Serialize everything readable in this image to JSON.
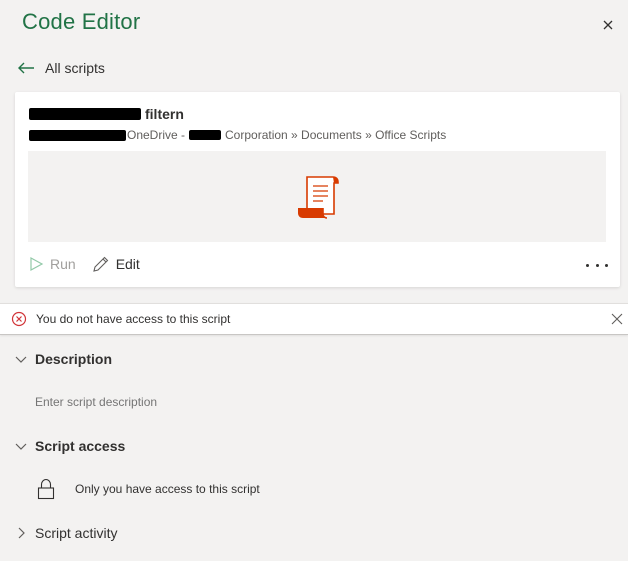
{
  "header": {
    "title": "Code Editor",
    "close_icon": "close-icon"
  },
  "nav": {
    "back_label": "All scripts"
  },
  "script_card": {
    "name_visible": "filtern",
    "path_onedrive": "OneDrive -",
    "path_rest": "Corporation » Documents » Office Scripts",
    "run_label": "Run",
    "edit_label": "Edit",
    "script_icon_color": "#d83b01"
  },
  "alert": {
    "message": "You do not have access to this script",
    "color": "#d13438"
  },
  "sections": {
    "description": {
      "label": "Description",
      "placeholder": "Enter script description"
    },
    "script_access": {
      "label": "Script access",
      "text": "Only you have access to this script"
    },
    "script_activity": {
      "label": "Script activity"
    }
  },
  "colors": {
    "brand": "#217346",
    "background": "#f3f2f1"
  }
}
